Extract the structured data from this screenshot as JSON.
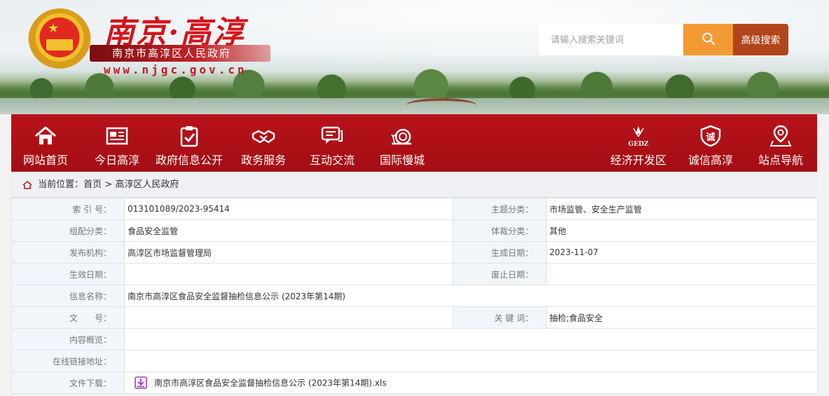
{
  "header": {
    "title": "南京·高淳",
    "subtitle": "南京市高淳区人民政府",
    "url": "www.njgc.gov.cn",
    "search_placeholder": "请输入搜索关键词",
    "advanced_search": "高级搜索"
  },
  "nav": {
    "items": [
      {
        "label": "网站首页",
        "icon": "home-icon"
      },
      {
        "label": "今日高淳",
        "icon": "newspaper-icon"
      },
      {
        "label": "政府信息公开",
        "icon": "clipboard-check-icon"
      },
      {
        "label": "政务服务",
        "icon": "handshake-icon"
      },
      {
        "label": "互动交流",
        "icon": "chat-icon"
      },
      {
        "label": "国际慢城",
        "icon": "snail-icon"
      },
      {
        "label": "经济开发区",
        "icon": "gedz-logo-icon"
      },
      {
        "label": "诚信高淳",
        "icon": "integrity-shield-icon"
      },
      {
        "label": "站点导航",
        "icon": "location-pin-icon"
      }
    ],
    "gedz_text": "GEDZ",
    "cheng_text": "诚"
  },
  "breadcrumb": {
    "prefix": "当前位置：",
    "home": "首页",
    "sep": ">",
    "current": "高淳区人民政府"
  },
  "info": {
    "index_label": "索 引 号：",
    "index_value": "013101089/2023-95414",
    "topic_label": "主题分类：",
    "topic_value": "市场监管、安全生产监管",
    "org_category_label": "组配分类：",
    "org_category_value": "食品安全监管",
    "genre_label": "体裁分类：",
    "genre_value": "其他",
    "publisher_label": "发布机构：",
    "publisher_value": "高淳区市场监督管理局",
    "created_label": "生成日期：",
    "created_value": "2023-11-07",
    "effective_label": "生效日期：",
    "effective_value": "",
    "abolish_label": "废止日期：",
    "abolish_value": "",
    "name_label": "信息名称：",
    "name_value": "南京市高淳区食品安全监督抽检信息公示 (2023年第14期)",
    "doc_no_label": "文　　号：",
    "doc_no_value": "",
    "keywords_label": "关 键 词：",
    "keywords_value": "抽检;食品安全",
    "summary_label": "内容概览：",
    "summary_value": "",
    "link_label": "在线链接地址：",
    "link_value": "",
    "file_label": "文件下载：",
    "file_value": "南京市高淳区食品安全监督抽检信息公示 (2023年第14期).xls"
  },
  "colors": {
    "nav_red": "#a30d14",
    "search_orange": "#f39a35",
    "advanced_brown": "#b2441b",
    "title_red": "#d4141c",
    "label_bg": "#f1f6fb"
  }
}
